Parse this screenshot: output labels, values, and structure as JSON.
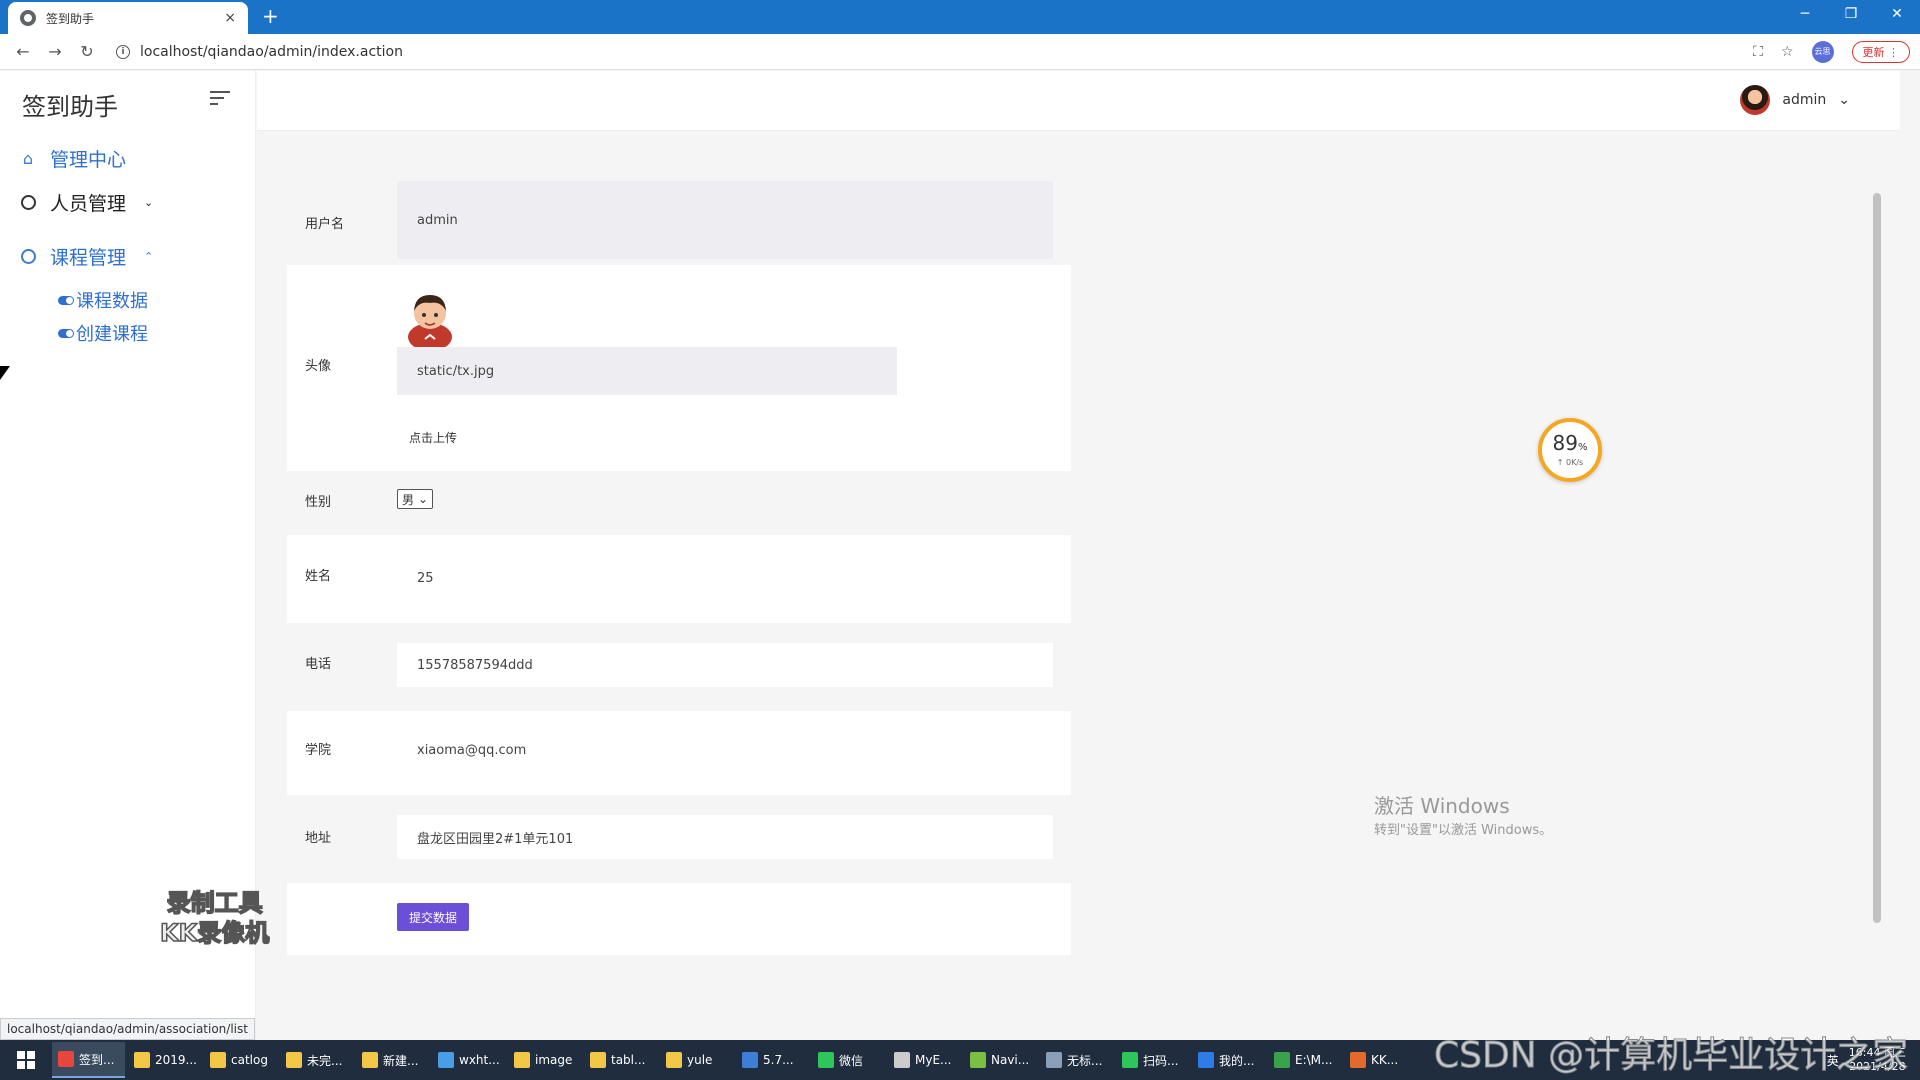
{
  "browser": {
    "tab_title": "签到助手",
    "tab_close": "×",
    "new_tab": "+",
    "url": "localhost/qiandao/admin/index.action",
    "update_label": "更新",
    "ext_label": "云思"
  },
  "sidebar": {
    "brand": "签到助手",
    "items": [
      {
        "label": "管理中心"
      },
      {
        "label": "人员管理",
        "chevron": "⌄"
      },
      {
        "label": "课程管理",
        "chevron": "⌃"
      }
    ],
    "subitems": [
      {
        "label": "课程数据"
      },
      {
        "label": "创建课程"
      }
    ],
    "status_url": "localhost/qiandao/admin/association/list"
  },
  "header": {
    "user_name": "admin",
    "chevron": "⌄"
  },
  "form": {
    "username_label": "用户名",
    "username_value": "admin",
    "avatar_label": "头像",
    "avatar_path": "static/tx.jpg",
    "upload_label": "点击上传",
    "gender_label": "性别",
    "gender_value": "男",
    "name_label": "姓名",
    "name_value": "25",
    "phone_label": "电话",
    "phone_value": "15578587594ddd",
    "college_label": "学院",
    "college_value": "xiaoma@qq.com",
    "address_label": "地址",
    "address_value": "盘龙区田园里2#1单元101",
    "submit_label": "提交数据"
  },
  "overlay": {
    "progress_pct": "89",
    "progress_unit": "%",
    "speed": "↑ 0K/s",
    "activate_title": "激活 Windows",
    "activate_sub": "转到\"设置\"以激活 Windows。",
    "watermark_line1": "录制工具",
    "watermark_line2": "KK录像机",
    "csdn": "CSDN @计算机毕业设计之家"
  },
  "taskbar": {
    "items": [
      {
        "label": "签到...",
        "color": "#e8453c"
      },
      {
        "label": "2019...",
        "color": "#f3c847"
      },
      {
        "label": "catlog",
        "color": "#f3c847"
      },
      {
        "label": "未完...",
        "color": "#f3c847"
      },
      {
        "label": "新建...",
        "color": "#f3c847"
      },
      {
        "label": "wxht...",
        "color": "#4a9ee8"
      },
      {
        "label": "image",
        "color": "#f3c847"
      },
      {
        "label": "tabl...",
        "color": "#f3c847"
      },
      {
        "label": "yule",
        "color": "#f3c847"
      },
      {
        "label": "5.7...",
        "color": "#3d7fd6"
      },
      {
        "label": "微信",
        "color": "#2ec55a"
      },
      {
        "label": "MyE...",
        "color": "#cccccc"
      },
      {
        "label": "Navi...",
        "color": "#7bc043"
      },
      {
        "label": "无标...",
        "color": "#8aa0b8"
      },
      {
        "label": "扫码...",
        "color": "#2ec55a"
      },
      {
        "label": "我的...",
        "color": "#2f7be8"
      },
      {
        "label": "E:\\M...",
        "color": "#3aa34a"
      },
      {
        "label": "KK...",
        "color": "#e36a2a"
      }
    ],
    "ime": "英",
    "time": "16:44 周三",
    "date": "2021/4/28"
  }
}
